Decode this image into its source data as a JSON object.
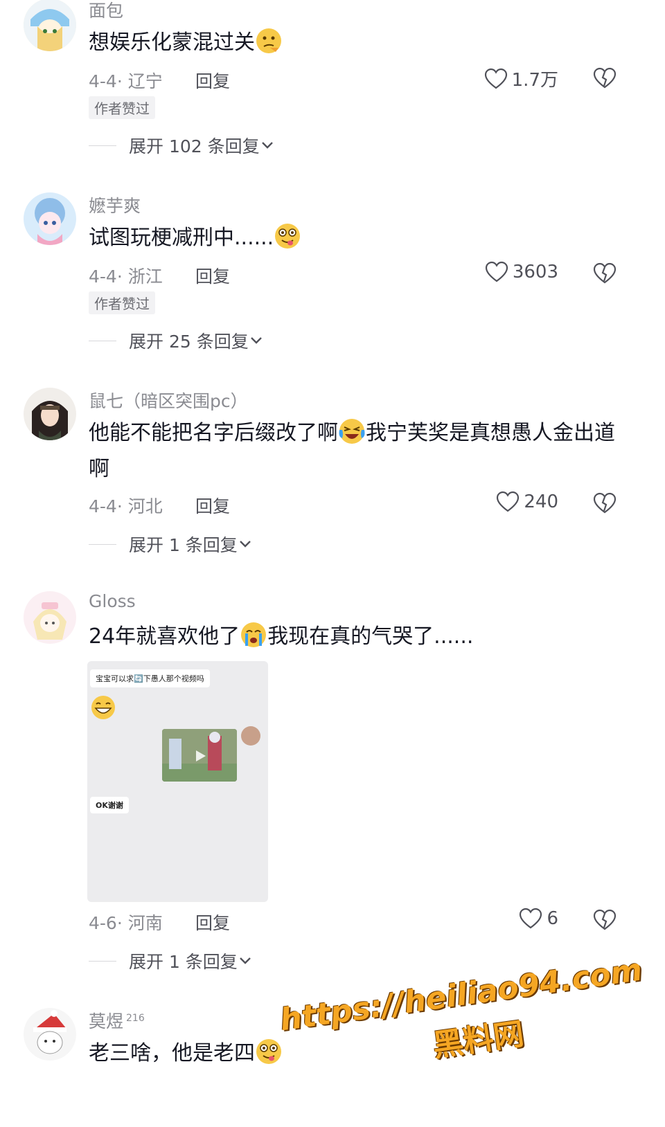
{
  "comments": [
    {
      "user": "面包",
      "text": "想娱乐化蒙混过关",
      "date": "4-4· 辽宁",
      "reply": "回复",
      "likes": "1.7万",
      "badge": "作者赞过",
      "expand": "展开 102 条回复"
    },
    {
      "user": "嬷芋爽",
      "text": "试图玩梗减刑中......",
      "date": "4-4· 浙江",
      "reply": "回复",
      "likes": "3603",
      "badge": "作者赞过",
      "expand": "展开 25 条回复"
    },
    {
      "user": "鼠七（暗区突围pc）",
      "text": "他能不能把名字后缀改了啊",
      "text2": "我宁芙奖是真想愚人金出道啊",
      "date": "4-4· 河北",
      "reply": "回复",
      "likes": "240",
      "expand": "展开 1 条回复"
    },
    {
      "user": "Gloss",
      "text": "24年就喜欢他了",
      "text2": "我现在真的气哭了......",
      "date": "4-6· 河南",
      "reply": "回复",
      "likes": "6",
      "expand": "展开 1 条回复",
      "image": {
        "bubble1": "宝宝可以求🔄下愚人那个视频吗",
        "bubble2": "OK谢谢"
      }
    },
    {
      "user": "莫煜",
      "user_sup": "216",
      "text": "老三啥，他是老四"
    }
  ],
  "watermark": {
    "url": "https://heiliao94.com",
    "name": "黑料网"
  },
  "icons": {
    "like": "heart-outline-icon",
    "dislike": "broken-heart-icon",
    "expand": "chevron-down-icon"
  },
  "colors": {
    "text": "#161823",
    "meta": "#8a8b91",
    "watermark": "#f5a623"
  }
}
